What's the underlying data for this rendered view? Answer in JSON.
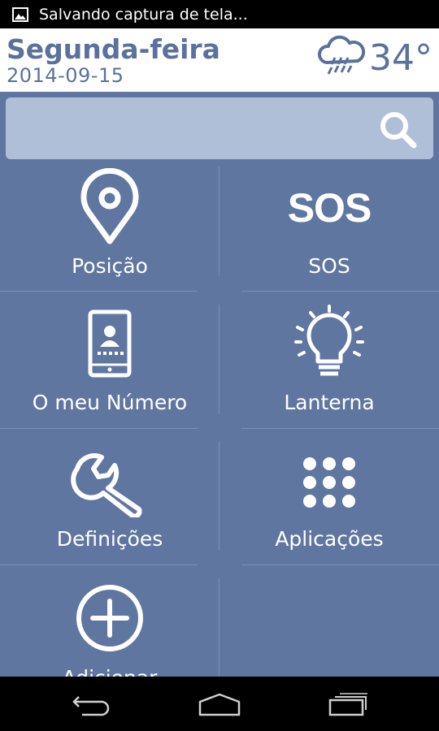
{
  "status_bar": {
    "notification_text": "Salvando captura de tela..."
  },
  "header": {
    "day": "Segunda-feira",
    "date": "2014-09-15",
    "temperature": "34°"
  },
  "search": {
    "placeholder": ""
  },
  "tiles": [
    {
      "label": "Posição",
      "icon": "location-pin-icon"
    },
    {
      "label": "SOS",
      "icon": "sos-icon",
      "icon_text": "SOS"
    },
    {
      "label": "O meu Número",
      "icon": "phone-contact-icon"
    },
    {
      "label": "Lanterna",
      "icon": "lightbulb-icon"
    },
    {
      "label": "Definições",
      "icon": "wrench-icon"
    },
    {
      "label": "Aplicações",
      "icon": "apps-grid-icon"
    },
    {
      "label": "Adicionar",
      "icon": "add-circle-icon"
    }
  ],
  "colors": {
    "background": "#5f76a0",
    "accent_text": "#5a719d",
    "search_bg": "#b0bfd8"
  }
}
